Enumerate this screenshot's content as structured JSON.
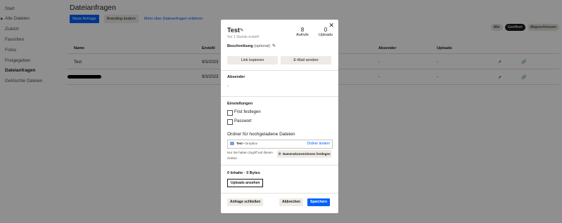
{
  "sidebar": {
    "items": [
      {
        "label": "Start"
      },
      {
        "label": "Alle Dateien"
      },
      {
        "label": "Zuletzt"
      },
      {
        "label": "Favoriten"
      },
      {
        "label": "Fotos"
      },
      {
        "label": "Freigegeben"
      },
      {
        "label": "Dateianfragen"
      },
      {
        "label": "Gelöschte Dateien"
      }
    ],
    "active": "Dateianfragen"
  },
  "header": {
    "title": "Dateianfragen",
    "new_request": "Neue Anfrage",
    "branding": "Branding ändern",
    "learn_more": "Mehr über Dateianfragen erfahren"
  },
  "filters": {
    "all": "Alle",
    "open": "Geöffnet",
    "closed": "Abgeschlossen",
    "selected": "Geöffnet"
  },
  "table": {
    "columns": [
      "Name",
      "Erstellt",
      "Absender",
      "Uploads"
    ],
    "rows": [
      {
        "name": "Test",
        "created": "9/3/2023",
        "sender": "-",
        "uploads": "-"
      },
      {
        "name": "",
        "created": "9/3/2023",
        "sender": "-",
        "uploads": "-"
      }
    ]
  },
  "modal": {
    "title": "Test",
    "subtitle": "Vor 1 Stunde erstellt",
    "views_count": "8",
    "views_label": "Aufrufe",
    "uploads_count": "0",
    "uploads_label": "Uploads",
    "description_label": "Beschreibung",
    "description_optional": "(optional)",
    "copy_link": "Link kopieren",
    "send_email": "E-Mail senden",
    "sender_heading": "Absender",
    "sender_value": "-",
    "settings_heading": "Einstellungen",
    "deadline_label": "Frist festlegen",
    "password_label": "Passwort",
    "folder_heading": "Ordner für hochgeladene Dateien",
    "folder_name": "Test",
    "folder_location": "• Dropbox",
    "change_folder": "Ordner ändern",
    "access_note": "Nur Sie haben Zugriff auf diesen Ordner",
    "naming_button": "Namenskonventionen festlegen",
    "contents_summary": "0 Inhalte · 0 Bytes",
    "view_uploads": "Uploads ansehen",
    "close_request": "Anfrage schließen",
    "cancel": "Abbrechen",
    "save": "Speichern"
  },
  "icons": {
    "close": "close-icon",
    "edit": "pencil-icon",
    "folder": "folder-icon",
    "send": "send-icon",
    "link": "link-icon",
    "naming": "gear-icon"
  },
  "colors": {
    "accent": "#0061fe",
    "overlay": "rgba(0,0,0,0.44)"
  }
}
